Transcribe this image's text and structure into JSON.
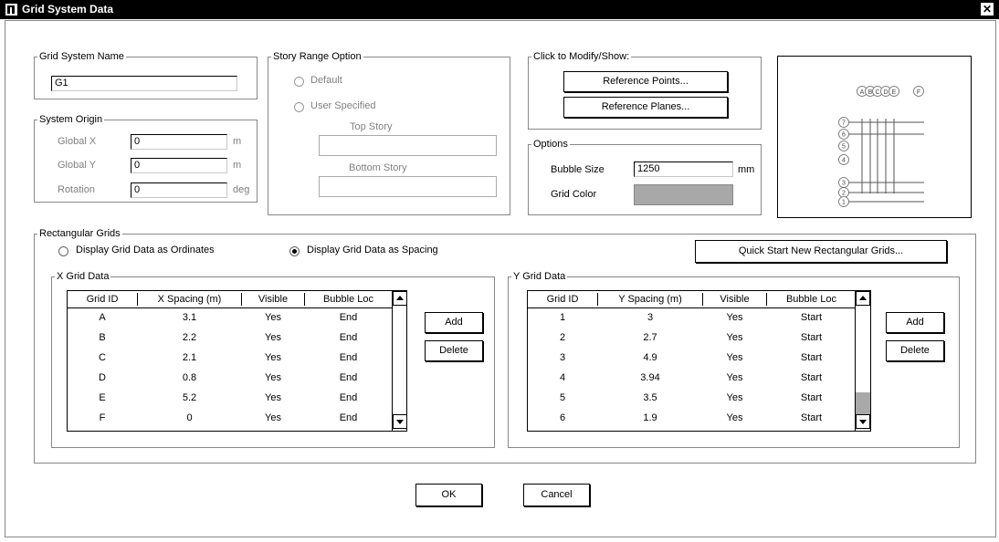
{
  "window": {
    "title": "Grid System Data",
    "close_glyph": "✕"
  },
  "grid_system_name": {
    "legend": "Grid System Name",
    "value": "G1"
  },
  "system_origin": {
    "legend": "System Origin",
    "global_x": {
      "label": "Global X",
      "value": "0",
      "unit": "m"
    },
    "global_y": {
      "label": "Global Y",
      "value": "0",
      "unit": "m"
    },
    "rotation": {
      "label": "Rotation",
      "value": "0",
      "unit": "deg"
    }
  },
  "story_range": {
    "legend": "Story Range Option",
    "default_label": "Default",
    "user_specified_label": "User Specified",
    "top_story_label": "Top Story",
    "bottom_story_label": "Bottom Story"
  },
  "modify_show": {
    "legend": "Click to Modify/Show:",
    "reference_points": "Reference Points...",
    "reference_planes": "Reference Planes..."
  },
  "options": {
    "legend": "Options",
    "bubble_size_label": "Bubble Size",
    "bubble_size_value": "1250",
    "bubble_size_unit": "mm",
    "grid_color_label": "Grid Color",
    "grid_color": "#a8a8a8"
  },
  "preview": {
    "x_bubbles": [
      "A",
      "B",
      "C",
      "D",
      "E",
      "F"
    ],
    "y_bubbles": [
      "7",
      "6",
      "5",
      "4",
      "3",
      "2",
      "1"
    ]
  },
  "rectangular_grids": {
    "legend": "Rectangular Grids",
    "ordinates_label": "Display Grid Data as Ordinates",
    "spacing_label": "Display Grid Data as Spacing",
    "selected": "spacing",
    "quick_start": "Quick Start New Rectangular Grids..."
  },
  "x_grid": {
    "legend": "X Grid Data",
    "headers": [
      "Grid ID",
      "X Spacing  (m)",
      "Visible",
      "Bubble Loc"
    ],
    "rows": [
      [
        "A",
        "3.1",
        "Yes",
        "End"
      ],
      [
        "B",
        "2.2",
        "Yes",
        "End"
      ],
      [
        "C",
        "2.1",
        "Yes",
        "End"
      ],
      [
        "D",
        "0.8",
        "Yes",
        "End"
      ],
      [
        "E",
        "5.2",
        "Yes",
        "End"
      ],
      [
        "F",
        "0",
        "Yes",
        "End"
      ]
    ],
    "add": "Add",
    "delete": "Delete"
  },
  "y_grid": {
    "legend": "Y Grid Data",
    "headers": [
      "Grid ID",
      "Y Spacing  (m)",
      "Visible",
      "Bubble Loc"
    ],
    "rows": [
      [
        "1",
        "3",
        "Yes",
        "Start"
      ],
      [
        "2",
        "2.7",
        "Yes",
        "Start"
      ],
      [
        "3",
        "4.9",
        "Yes",
        "Start"
      ],
      [
        "4",
        "3.94",
        "Yes",
        "Start"
      ],
      [
        "5",
        "3.5",
        "Yes",
        "Start"
      ],
      [
        "6",
        "1.9",
        "Yes",
        "Start"
      ]
    ],
    "add": "Add",
    "delete": "Delete"
  },
  "footer": {
    "ok": "OK",
    "cancel": "Cancel"
  }
}
